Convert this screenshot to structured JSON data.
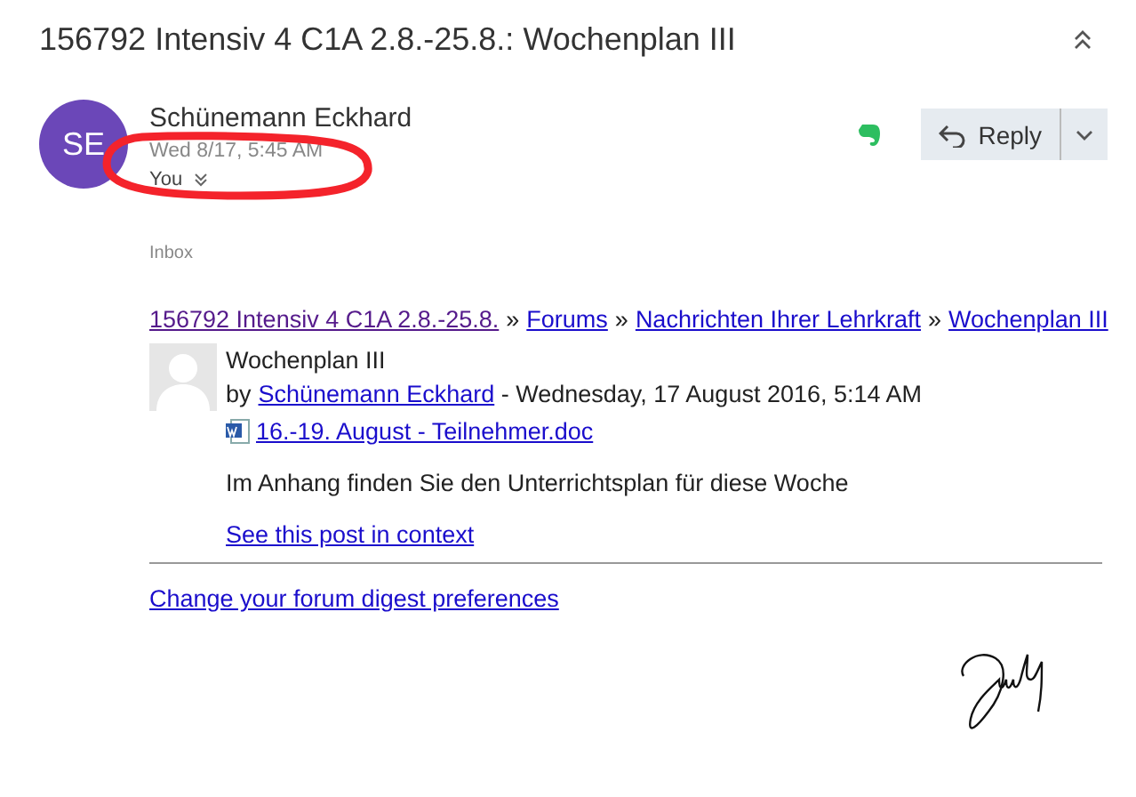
{
  "subject": "156792 Intensiv 4 C1A 2.8.-25.8.: Wochenplan III",
  "message": {
    "avatar_initials": "SE",
    "sender": "Schünemann Eckhard",
    "date": "Wed 8/17, 5:45 AM",
    "recipient": "You",
    "folder": "Inbox"
  },
  "reply_button": {
    "label": "Reply"
  },
  "breadcrumb": [
    {
      "label": "156792 Intensiv 4 C1A 2.8.-25.8.",
      "visited": true
    },
    {
      "label": "Forums",
      "visited": false
    },
    {
      "label": "Nachrichten Ihrer Lehrkraft",
      "visited": false
    },
    {
      "label": "Wochenplan III",
      "visited": false
    }
  ],
  "breadcrumb_separator": "»",
  "post": {
    "title": "Wochenplan III",
    "by": "by",
    "author": "Schünemann Eckhard",
    "date": " - Wednesday, 17 August 2016, 5:14 AM",
    "attachment": "16.-19. August - Teilnehmer.doc",
    "body": "Im Anhang finden Sie den Unterrichtsplan für diese Woche",
    "context_link": "See this post in context"
  },
  "footer_link": "Change your forum digest preferences"
}
